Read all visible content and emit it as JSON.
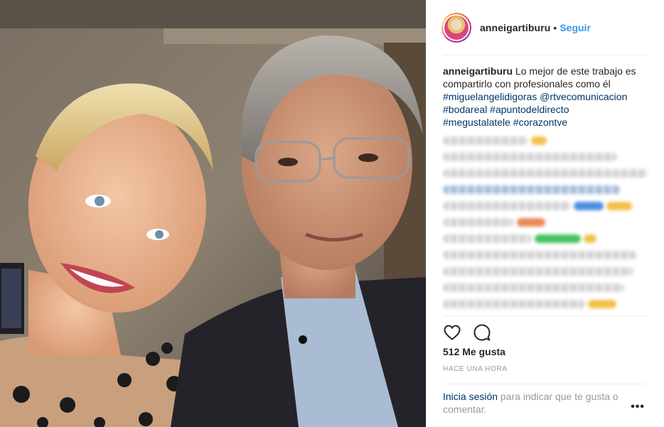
{
  "post": {
    "photo_alt": "",
    "username": "anneigartiburu",
    "separator": "•",
    "follow_label": "Seguir",
    "caption": {
      "username": "anneigartiburu",
      "text": "Lo mejor de este trabajo es compartirlo con profesionales como él",
      "hashtags": [
        "#miguelangelidigoras",
        "@rtvecomunicacion",
        "#bodareal",
        "#apuntodeldirecto",
        "#megustalatele",
        "#corazontve"
      ]
    },
    "likes": "512 Me gusta",
    "timestamp": "HACE UNA HORA",
    "login": {
      "link_label": "Inicia sesión",
      "rest_text": " para indicar que te gusta o comentar."
    },
    "more_label": "•••",
    "icons": {
      "like": "heart-icon",
      "comment": "comment-icon",
      "more": "ellipsis-icon"
    }
  },
  "colors": {
    "link_blue": "#3897f0",
    "hashtag_blue": "#003569",
    "muted": "#999999"
  }
}
